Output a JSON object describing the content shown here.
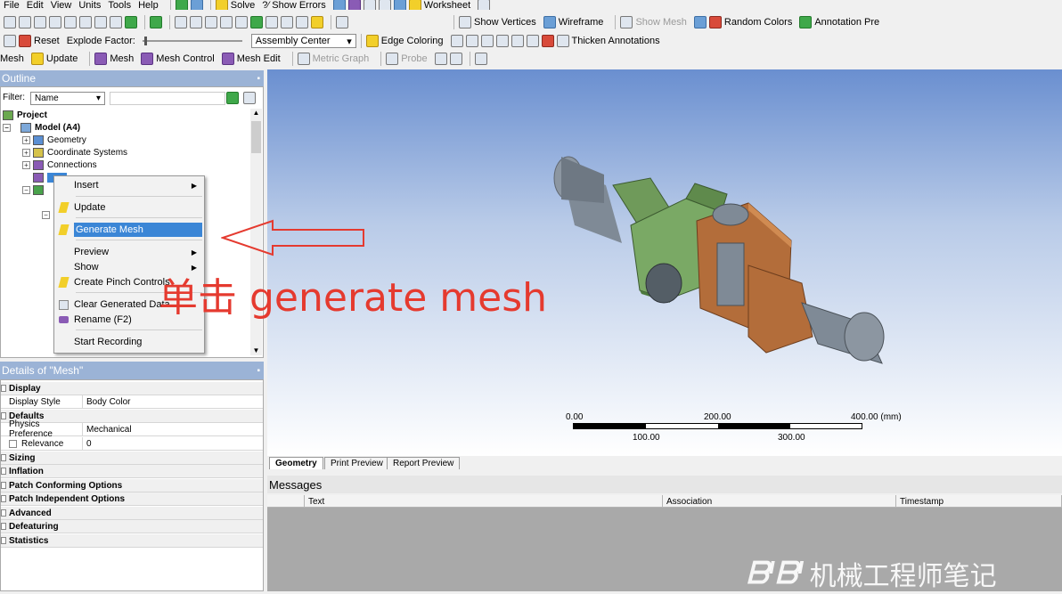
{
  "menubar": {
    "items": [
      "File",
      "Edit",
      "View",
      "Units",
      "Tools",
      "Help"
    ],
    "solve": "Solve",
    "show_errors": "?⁄ Show Errors",
    "worksheet": "Worksheet"
  },
  "toolbar2": {
    "show_vertices": "Show Vertices",
    "wireframe": "Wireframe",
    "show_mesh": "Show Mesh",
    "random_colors": "Random Colors",
    "annotation_prefs": "Annotation Pre"
  },
  "toolbar3": {
    "reset": "Reset",
    "explode_factor": "Explode Factor:",
    "assembly_center": "Assembly Center",
    "edge_coloring": "Edge Coloring",
    "thicken_annotations": "Thicken Annotations"
  },
  "toolbar4": {
    "mesh": "Mesh",
    "update": "Update",
    "mesh_dropdown": "Mesh",
    "mesh_control": "Mesh Control",
    "mesh_edit": "Mesh Edit",
    "metric_graph": "Metric Graph",
    "probe": "Probe"
  },
  "outline": {
    "title": "Outline",
    "filter_label": "Filter:",
    "filter_value": "Name",
    "project": "Project",
    "model": "Model (A4)",
    "geometry": "Geometry",
    "coordinate_systems": "Coordinate Systems",
    "connections": "Connections"
  },
  "context_menu": {
    "insert": "Insert",
    "update": "Update",
    "generate_mesh": "Generate Mesh",
    "preview": "Preview",
    "show": "Show",
    "create_pinch_controls": "Create Pinch Controls",
    "clear_generated_data": "Clear Generated Data",
    "rename": "Rename (F2)",
    "start_recording": "Start Recording"
  },
  "annotation": {
    "text": "单击 generate mesh",
    "color": "#e53a2f"
  },
  "details": {
    "title": "Details of \"Mesh\"",
    "groups": {
      "display": "Display",
      "defaults": "Defaults",
      "sizing": "Sizing",
      "inflation": "Inflation",
      "patch_conforming": "Patch Conforming Options",
      "patch_independent": "Patch Independent Options",
      "advanced": "Advanced",
      "defeaturing": "Defeaturing",
      "statistics": "Statistics"
    },
    "rows": {
      "display_style": {
        "k": "Display Style",
        "v": "Body Color"
      },
      "physics_preference": {
        "k": "Physics Preference",
        "v": "Mechanical"
      },
      "relevance": {
        "k": "Relevance",
        "v": "0"
      }
    }
  },
  "scale_bar": {
    "labels_top": [
      "0.00",
      "200.00",
      "400.00 (mm)"
    ],
    "labels_bottom": [
      "100.00",
      "300.00"
    ]
  },
  "view_tabs": [
    "Geometry",
    "Print Preview",
    "Report Preview"
  ],
  "messages": {
    "title": "Messages",
    "columns": [
      "Text",
      "Association",
      "Timestamp"
    ]
  },
  "watermark": "机械工程师笔记",
  "colors": {
    "viewport_top": "#6a8fd0",
    "viewport_bottom": "#ffffff",
    "panel_header": "#9bb3d6",
    "highlight": "#3b86d6",
    "green_part": "#6f9a5a",
    "copper_part": "#b36d3a",
    "shaft": "#7f8a96"
  }
}
